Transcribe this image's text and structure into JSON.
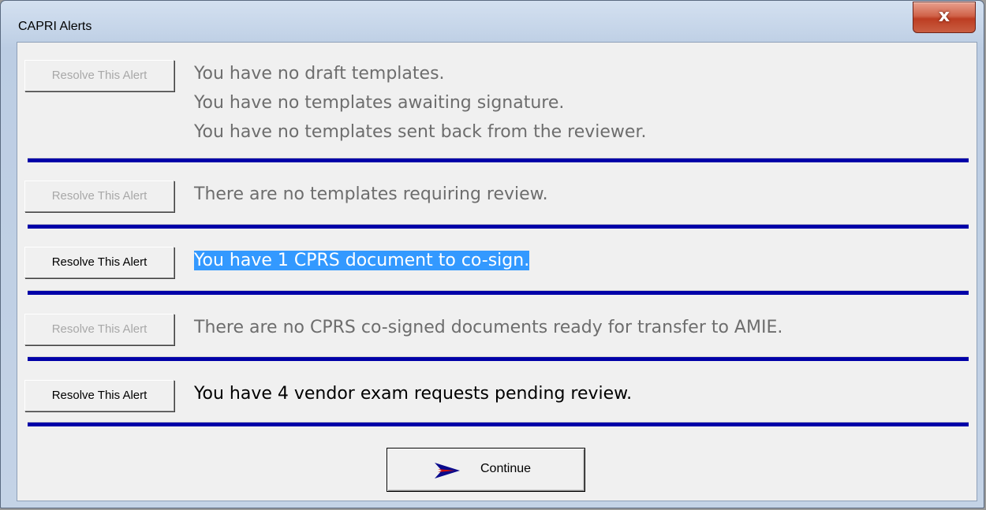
{
  "window": {
    "title": "CAPRI Alerts",
    "close_glyph": "x"
  },
  "alerts": [
    {
      "button_label": "Resolve This Alert",
      "enabled": false,
      "lines": [
        "You have no draft templates.",
        "You have no templates awaiting signature.",
        "You have no templates sent back from the reviewer."
      ]
    },
    {
      "button_label": "Resolve This Alert",
      "enabled": false,
      "lines": [
        "There are no templates requiring review."
      ]
    },
    {
      "button_label": "Resolve This Alert",
      "enabled": true,
      "selected": true,
      "lines": [
        "You have 1 CPRS document to co-sign."
      ]
    },
    {
      "button_label": "Resolve This Alert",
      "enabled": false,
      "lines": [
        "There are no CPRS co-signed documents ready for transfer to AMIE."
      ]
    },
    {
      "button_label": "Resolve This Alert",
      "enabled": true,
      "lines": [
        "You have 4 vendor exam requests pending review."
      ]
    }
  ],
  "continue_button": {
    "label": "Continue",
    "icon": "arrow-right-icon"
  },
  "colors": {
    "separator": "#0000a8",
    "selection": "#3399ff",
    "disabled_text": "#6d6d6d",
    "arrow_fill": "#0a0a8c",
    "arrow_accent": "#cc1111"
  }
}
